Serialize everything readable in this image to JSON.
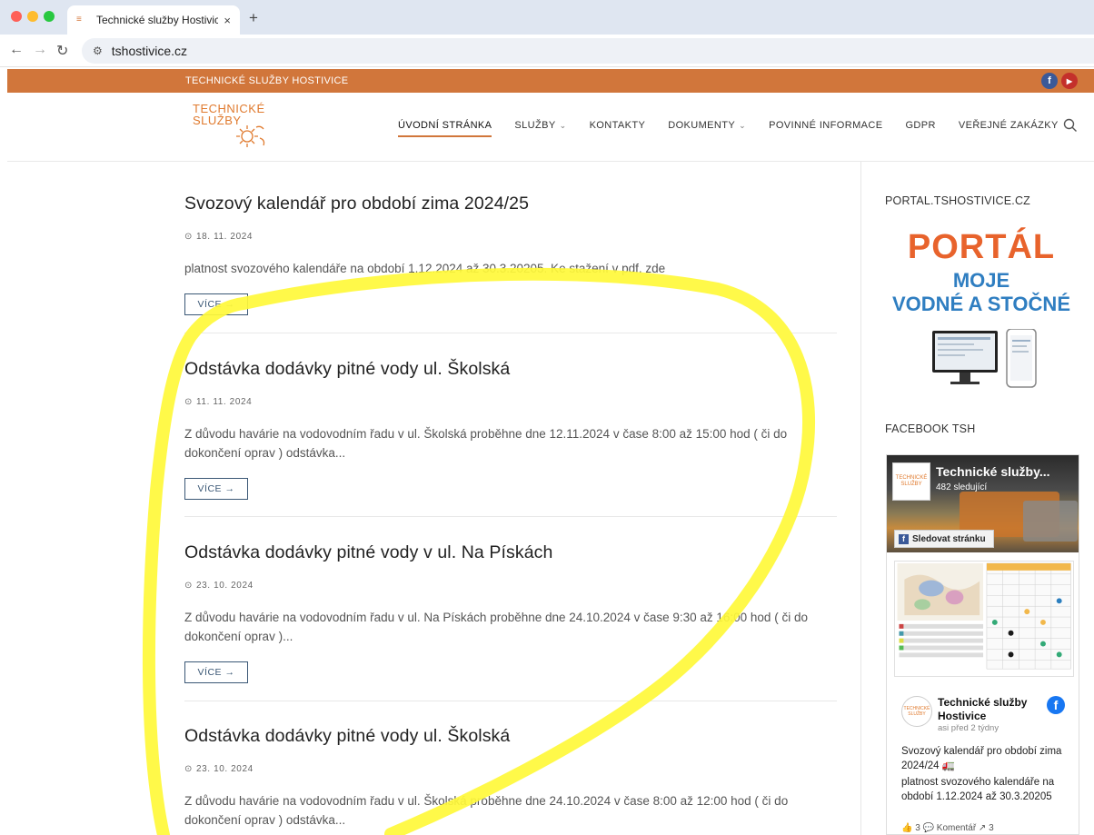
{
  "browser": {
    "tab_title": "Technické služby Hostivice –",
    "tab_close": "×",
    "new_tab": "+",
    "url": "tshostivice.cz"
  },
  "site": {
    "topbar_brand": "TECHNICKÉ SLUŽBY HOSTIVICE",
    "logo_line1": "TECHNICKÉ",
    "logo_line2": "SLUŽBY",
    "menu": {
      "home": "ÚVODNÍ STRÁNKA",
      "services": "SLUŽBY",
      "contacts": "KONTAKTY",
      "documents": "DOKUMENTY",
      "mandatory": "POVINNÉ INFORMACE",
      "gdpr": "GDPR",
      "tenders": "VEŘEJNÉ ZAKÁZKY"
    }
  },
  "posts": [
    {
      "title": "Svozový kalendář pro období zima 2024/25",
      "date": "18. 11. 2024",
      "excerpt": "platnost svozového kalendáře na období 1.12.2024 až 30.3.20205. Ke stažení v pdf. zde",
      "more": "VÍCE →"
    },
    {
      "title": "Odstávka dodávky pitné vody ul. Školská",
      "date": "11. 11. 2024",
      "excerpt": "Z důvodu havárie na vodovodním řadu v ul. Školská proběhne dne 12.11.2024 v čase 8:00 až 15:00 hod ( či do dokončení oprav ) odstávka...",
      "more": "VÍCE →"
    },
    {
      "title": "Odstávka dodávky pitné vody v ul. Na Pískách",
      "date": "23. 10. 2024",
      "excerpt": "Z důvodu havárie na vodovodním řadu v ul. Na Pískách proběhne dne 24.10.2024 v čase 9:30 až 16:00 hod ( či do dokončení oprav )...",
      "more": "VÍCE →"
    },
    {
      "title": "Odstávka dodávky pitné vody ul. Školská",
      "date": "23. 10. 2024",
      "excerpt": "Z důvodu havárie na vodovodním řadu v ul. Školská proběhne dne 24.10.2024 v čase 8:00 až 12:00 hod ( či do dokončení oprav ) odstávka..."
    }
  ],
  "sidebar": {
    "portal_title": "PORTAL.TSHOSTIVICE.CZ",
    "portal_word": "PORTÁL",
    "portal_moje": "MOJE",
    "portal_vodne": "VODNÉ A STOČNÉ",
    "facebook_title": "FACEBOOK TSH",
    "fb_page_name": "Technické služby...",
    "fb_followers": "482 sledující",
    "fb_follow": "Sledovat stránku",
    "fb_post_name": "Technické služby Hostivice",
    "fb_post_time": "asi před 2 týdny",
    "fb_post_text1": "Svozový kalendář pro období zima 2024/24 🚛",
    "fb_post_text2": "platnost svozového kalendáře na období 1.12.2024 až 30.3.20205",
    "fb_actions": "👍 3  💬 Komentář  ↗ 3"
  },
  "colors": {
    "brand_orange": "#d1763b",
    "annotation_yellow": "#fff93a",
    "button_blue": "#3a5775"
  }
}
